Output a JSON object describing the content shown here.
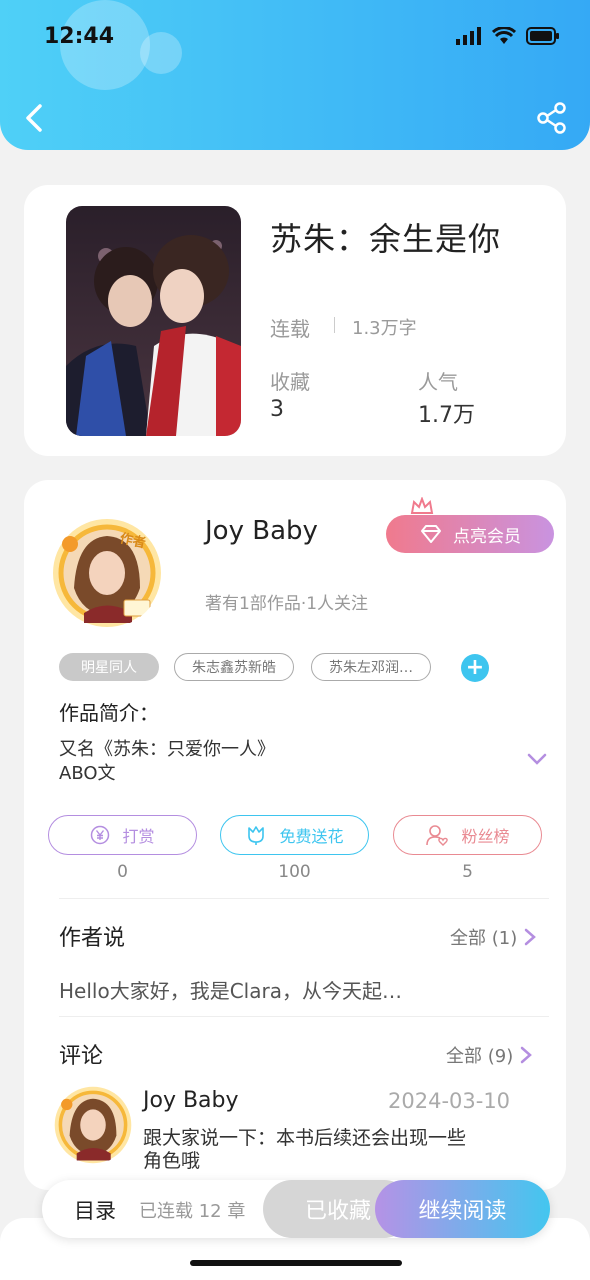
{
  "status": {
    "time": "12:44"
  },
  "book": {
    "title": "苏朱：余生是你",
    "status": "连载",
    "word_count": "1.3万字",
    "favorites_label": "收藏",
    "favorites_value": "3",
    "popularity_label": "人气",
    "popularity_value": "1.7万"
  },
  "author": {
    "name": "Joy Baby",
    "badge": "作者",
    "stats": "著有1部作品·1人关注",
    "vip_label": "点亮会员"
  },
  "tags": [
    "明星同人",
    "朱志鑫苏新皓",
    "苏朱左邓润…"
  ],
  "intro": {
    "heading": "作品简介：",
    "line1": "又名《苏朱：只爱你一人》",
    "line2": "ABO文"
  },
  "actions": [
    {
      "label": "打赏",
      "count": "0",
      "color": "#b48ee0"
    },
    {
      "label": "免费送花",
      "count": "100",
      "color": "#3ec5ef"
    },
    {
      "label": "粉丝榜",
      "count": "5",
      "color": "#e98a92"
    }
  ],
  "author_says": {
    "heading": "作者说",
    "all_label": "全部 (1)",
    "preview": "Hello大家好，我是Clara，从今天起…"
  },
  "comments": {
    "heading": "评论",
    "all_label": "全部 (9)",
    "items": [
      {
        "user": "Joy Baby",
        "date": "2024-03-10",
        "text_line1": "跟大家说一下：本书后续还会出现一些",
        "text_line2": "角色哦"
      }
    ]
  },
  "bottom": {
    "catalog_label": "目录",
    "chapters": "已连载 12 章",
    "collected_label": "已收藏",
    "continue_label": "继续阅读"
  }
}
